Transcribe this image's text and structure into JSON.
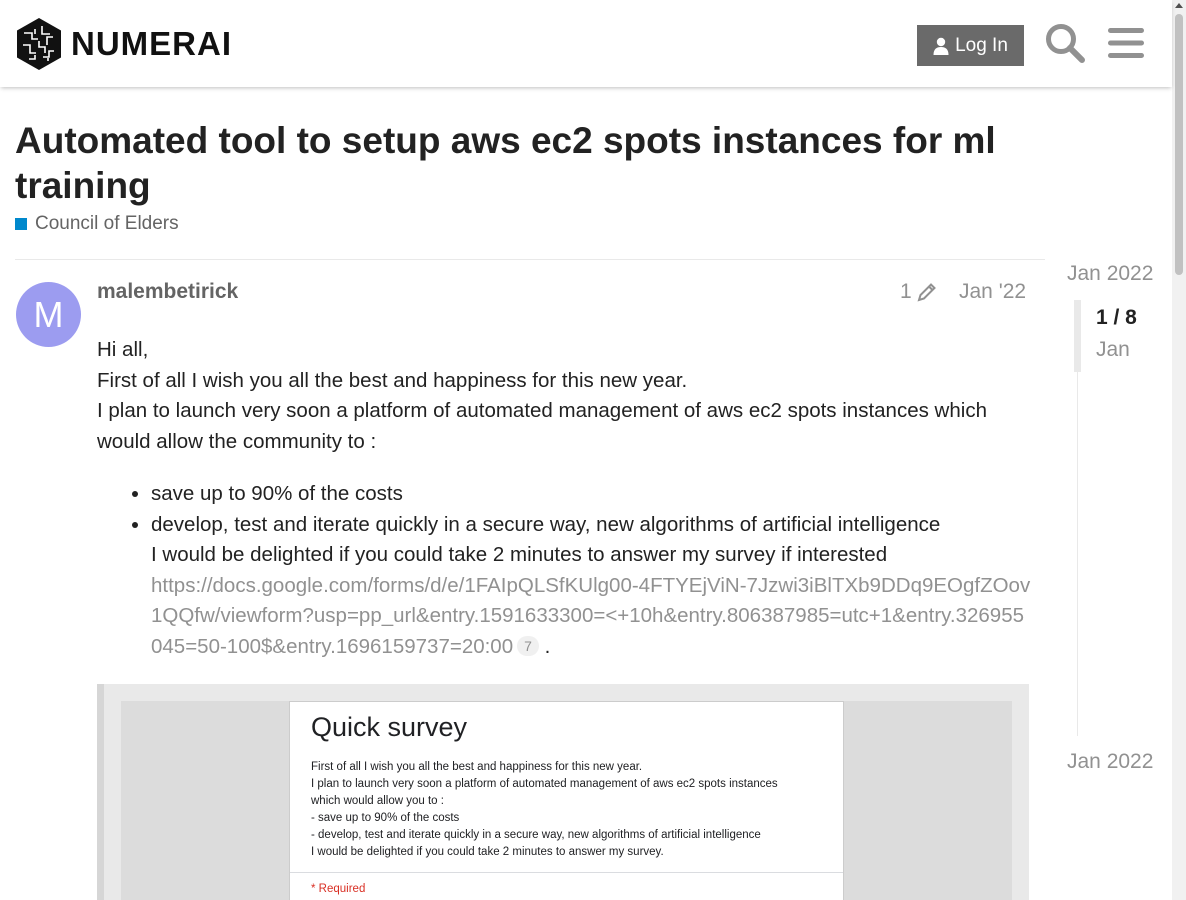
{
  "header": {
    "logo_text": "NUMERAI",
    "login_label": "Log In",
    "search_icon": "search-icon",
    "menu_icon": "hamburger-menu-icon"
  },
  "topic": {
    "title": "Automated tool to setup aws ec2 spots instances for ml training",
    "category": "Council of Elders",
    "category_color": "#0088cc"
  },
  "post": {
    "avatar_letter": "M",
    "avatar_color": "#9c9cf0",
    "username": "malembetirick",
    "edit_count": "1",
    "date": "Jan '22",
    "paragraphs": [
      "Hi all,",
      "First of all I wish you all the best and happiness for this new year.",
      "I plan to launch very soon a platform of automated management of aws ec2 spots instances which would allow the community to :"
    ],
    "bullets": [
      "save up to 90% of the costs",
      "develop, test and iterate quickly in a secure way, new algorithms of artificial intelligence"
    ],
    "survey_ask": "I would be delighted if you could take 2 minutes to answer my survey if interested",
    "link": "https://docs.google.com/forms/d/e/1FAIpQLSfKUlg00-4FTYEjViN-7Jzwi3iBlTXb9DDq9EOgfZOov1QQfw/viewform?usp=pp_url&entry.1591633300=<+10h&entry.806387985=utc+1&entry.326955045=50-100$&entry.1696159737=20:00",
    "link_clicks": "7",
    "trailing": "."
  },
  "survey_image": {
    "title": "Quick survey",
    "lines": [
      "First of all I wish you all the best and happiness for this new year.",
      "I plan to launch very soon a platform of automated management of aws ec2 spots instances",
      "which would allow you to :",
      "- save up to 90% of the costs",
      "- develop, test and iterate quickly in a secure way, new algorithms of artificial intelligence",
      "I would be delighted if you could take 2 minutes to answer my survey."
    ],
    "required": "* Required"
  },
  "timeline": {
    "top_date": "Jan 2022",
    "position": "1 / 8",
    "current_date": "Jan",
    "bottom_date": "Jan 2022"
  }
}
